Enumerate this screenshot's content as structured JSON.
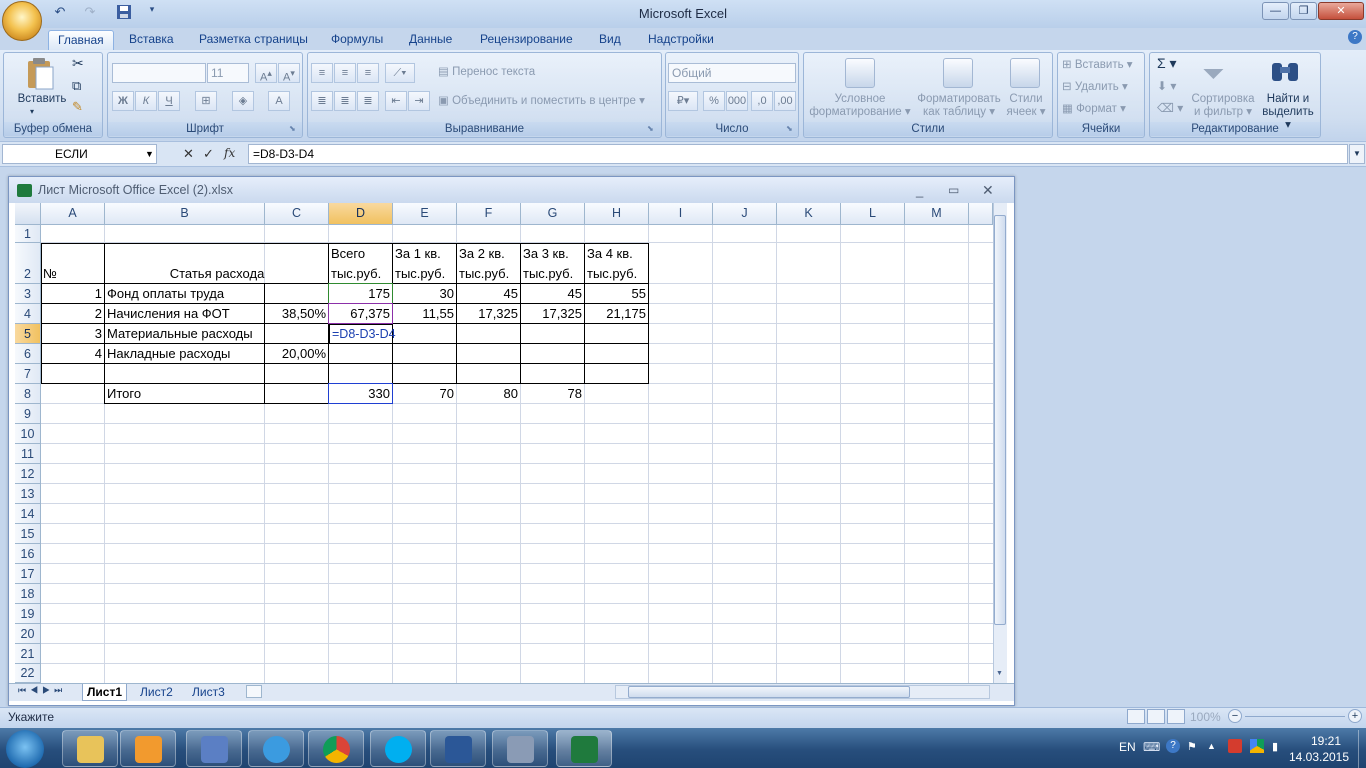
{
  "app": {
    "title": "Microsoft Excel"
  },
  "ribbon": {
    "tabs": [
      "Главная",
      "Вставка",
      "Разметка страницы",
      "Формулы",
      "Данные",
      "Рецензирование",
      "Вид",
      "Надстройки"
    ],
    "clipboard": {
      "paste": "Вставить",
      "label": "Буфер обмена"
    },
    "font": {
      "name": "",
      "size": "11",
      "label": "Шрифт"
    },
    "alignment": {
      "wrap": "Перенос текста",
      "merge": "Объединить и поместить в центре",
      "label": "Выравнивание"
    },
    "number": {
      "format": "Общий",
      "label": "Число"
    },
    "styles": {
      "conditional_1": "Условное",
      "conditional_2": "форматирование",
      "table_1": "Форматировать",
      "table_2": "как таблицу",
      "cell_1": "Стили",
      "cell_2": "ячеек",
      "label": "Стили"
    },
    "cells": {
      "insert": "Вставить",
      "delete": "Удалить",
      "format": "Формат",
      "label": "Ячейки"
    },
    "editing": {
      "sort_1": "Сортировка",
      "sort_2": "и фильтр",
      "find_1": "Найти и",
      "find_2": "выделить",
      "label": "Редактирование"
    }
  },
  "formula_bar": {
    "name_box": "ЕСЛИ",
    "formula": "=D8-D3-D4"
  },
  "workbook": {
    "title": "Лист Microsoft Office Excel (2).xlsx"
  },
  "grid": {
    "columns": [
      "A",
      "B",
      "C",
      "D",
      "E",
      "F",
      "G",
      "H",
      "I",
      "J",
      "K",
      "L",
      "M"
    ],
    "rows": [
      "1",
      "2",
      "3",
      "4",
      "5",
      "6",
      "7",
      "8",
      "9",
      "10",
      "11",
      "12",
      "13",
      "14",
      "15",
      "16",
      "17",
      "18",
      "19",
      "20",
      "21",
      "22"
    ],
    "header": {
      "a2": "№",
      "b2": "Статья расхода",
      "d1": "Всего",
      "d2": "тыс.руб.",
      "e1": "За 1 кв.",
      "e2": "тыс.руб.",
      "f1": "За 2 кв.",
      "f2": "тыс.руб.",
      "g1": "За 3 кв.",
      "g2": "тыс.руб.",
      "h1": "За 4 кв.",
      "h2": "тыс.руб."
    },
    "r3": {
      "a": "1",
      "b": "Фонд оплаты труда",
      "d": "175",
      "e": "30",
      "f": "45",
      "g": "45",
      "h": "55"
    },
    "r4": {
      "a": "2",
      "b": "Начисления на ФОТ",
      "c": "38,50%",
      "d": "67,375",
      "e": "11,55",
      "f": "17,325",
      "g": "17,325",
      "h": "21,175"
    },
    "r5": {
      "a": "3",
      "b": "Материальные расходы",
      "d_edit": "=D8-D3-D4"
    },
    "r6": {
      "a": "4",
      "b": "Накладные расходы",
      "c": "20,00%"
    },
    "r8": {
      "b": "Итого",
      "d": "330",
      "e": "70",
      "f": "80",
      "g": "78"
    }
  },
  "sheets": [
    "Лист1",
    "Лист2",
    "Лист3"
  ],
  "status": {
    "mode": "Укажите",
    "zoom": "100%"
  },
  "tray": {
    "lang": "EN",
    "time": "19:21",
    "date": "14.03.2015"
  }
}
